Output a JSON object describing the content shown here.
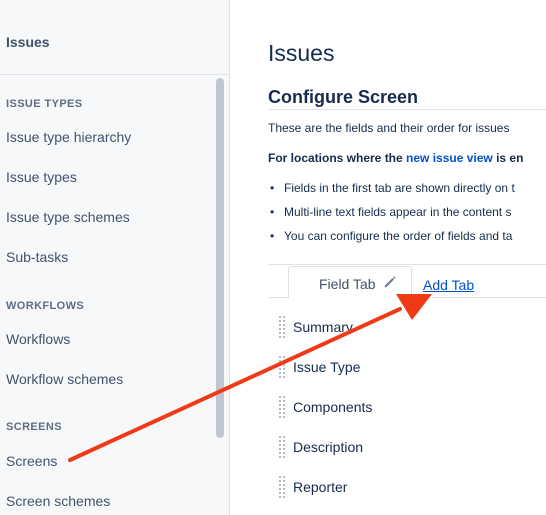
{
  "sidebar": {
    "title": "Issues",
    "sections": [
      {
        "heading": "ISSUE TYPES",
        "items": [
          "Issue type hierarchy",
          "Issue types",
          "Issue type schemes",
          "Sub-tasks"
        ]
      },
      {
        "heading": "WORKFLOWS",
        "items": [
          "Workflows",
          "Workflow schemes"
        ]
      },
      {
        "heading": "SCREENS",
        "items": [
          "Screens",
          "Screen schemes"
        ]
      }
    ]
  },
  "main": {
    "title": "Issues",
    "subtitle": "Configure Screen",
    "description": "These are the fields and their order for issues",
    "bold_prefix": "For locations where the ",
    "bold_link": "new issue view",
    "bold_suffix": " is en",
    "bullets": [
      "Fields in the first tab are shown directly on t",
      "Multi-line text fields appear in the content s",
      "You can configure the order of fields and ta"
    ],
    "tab_label": "Field Tab",
    "add_tab_label": "Add Tab",
    "fields": [
      "Summary",
      "Issue Type",
      "Components",
      "Description",
      "Reporter"
    ]
  },
  "icons": {
    "edit": "pencil-icon",
    "drag": "drag-handle-icon"
  },
  "colors": {
    "link": "#0052cc",
    "annotation_arrow": "#f03a17",
    "sidebar_bg": "#f7f8f9"
  }
}
